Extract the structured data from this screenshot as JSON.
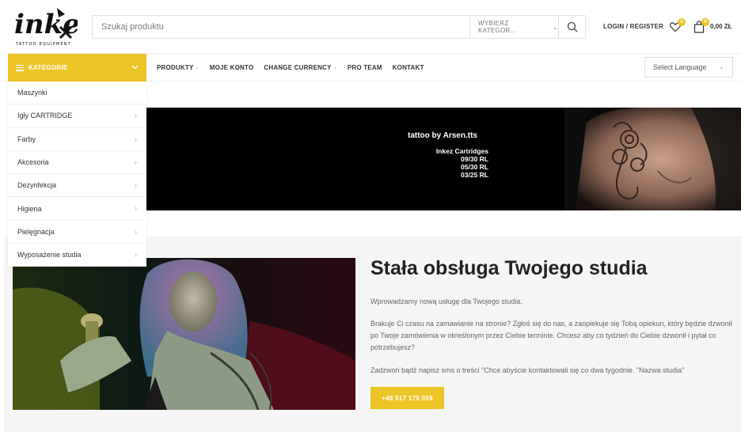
{
  "header": {
    "logo_text": "inkez",
    "logo_subtext": "TATTOO EQUIPMENT",
    "search_placeholder": "Szukaj produktu",
    "category_select": "WYBIERZ KATEGOR...",
    "login_label": "LOGIN / REGISTER",
    "wishlist_count": "0",
    "cart_count": "0",
    "cart_total": "0,00 ZŁ"
  },
  "nav": {
    "kategorie_label": "KATEGORIE",
    "links": [
      "PRODUKTY",
      "MOJE KONTO",
      "CHANGE CURRENCY",
      "PRO TEAM",
      "KONTAKT"
    ],
    "language_select": "Select Language"
  },
  "sidebar": {
    "items": [
      {
        "label": "Maszynki"
      },
      {
        "label": "Igły CARTRIDGE"
      },
      {
        "label": "Farby"
      },
      {
        "label": "Akcesoria"
      },
      {
        "label": "Dezynfekcja"
      },
      {
        "label": "Higiena"
      },
      {
        "label": "Pielęgnacja"
      },
      {
        "label": "Wyposażenie studia"
      }
    ]
  },
  "banner": {
    "title": "tattoo by Arsen.tts",
    "lines": [
      "Inkez Cartridges",
      "09/30 RL",
      "05/30 RL",
      "03/25 RL"
    ]
  },
  "service": {
    "title": "Stała obsługa Twojego studia",
    "p1": "Wprowadzamy nową usługę dla Twojego studia.",
    "p2": "Brakuje Ci czasu na zamawianie na stronie?  Zgłoś się do nas, a zaopiekuje się Tobą opiekun, który będzie dzwonił po Twoje zamówienia w określonym przez Ciebie terminie. Chcesz aby co tydzień do Ciebie dzwonił i pytał co potrzebujesz?",
    "p3": "Zadzwoń bądź napisz sms o treści \"Chce abyście kontaktowali się co dwa tygodnie. \"Nazwa studia\"",
    "phone_button": "+48 517 176 059"
  },
  "colors": {
    "accent": "#ecc426",
    "dark": "#222222"
  }
}
